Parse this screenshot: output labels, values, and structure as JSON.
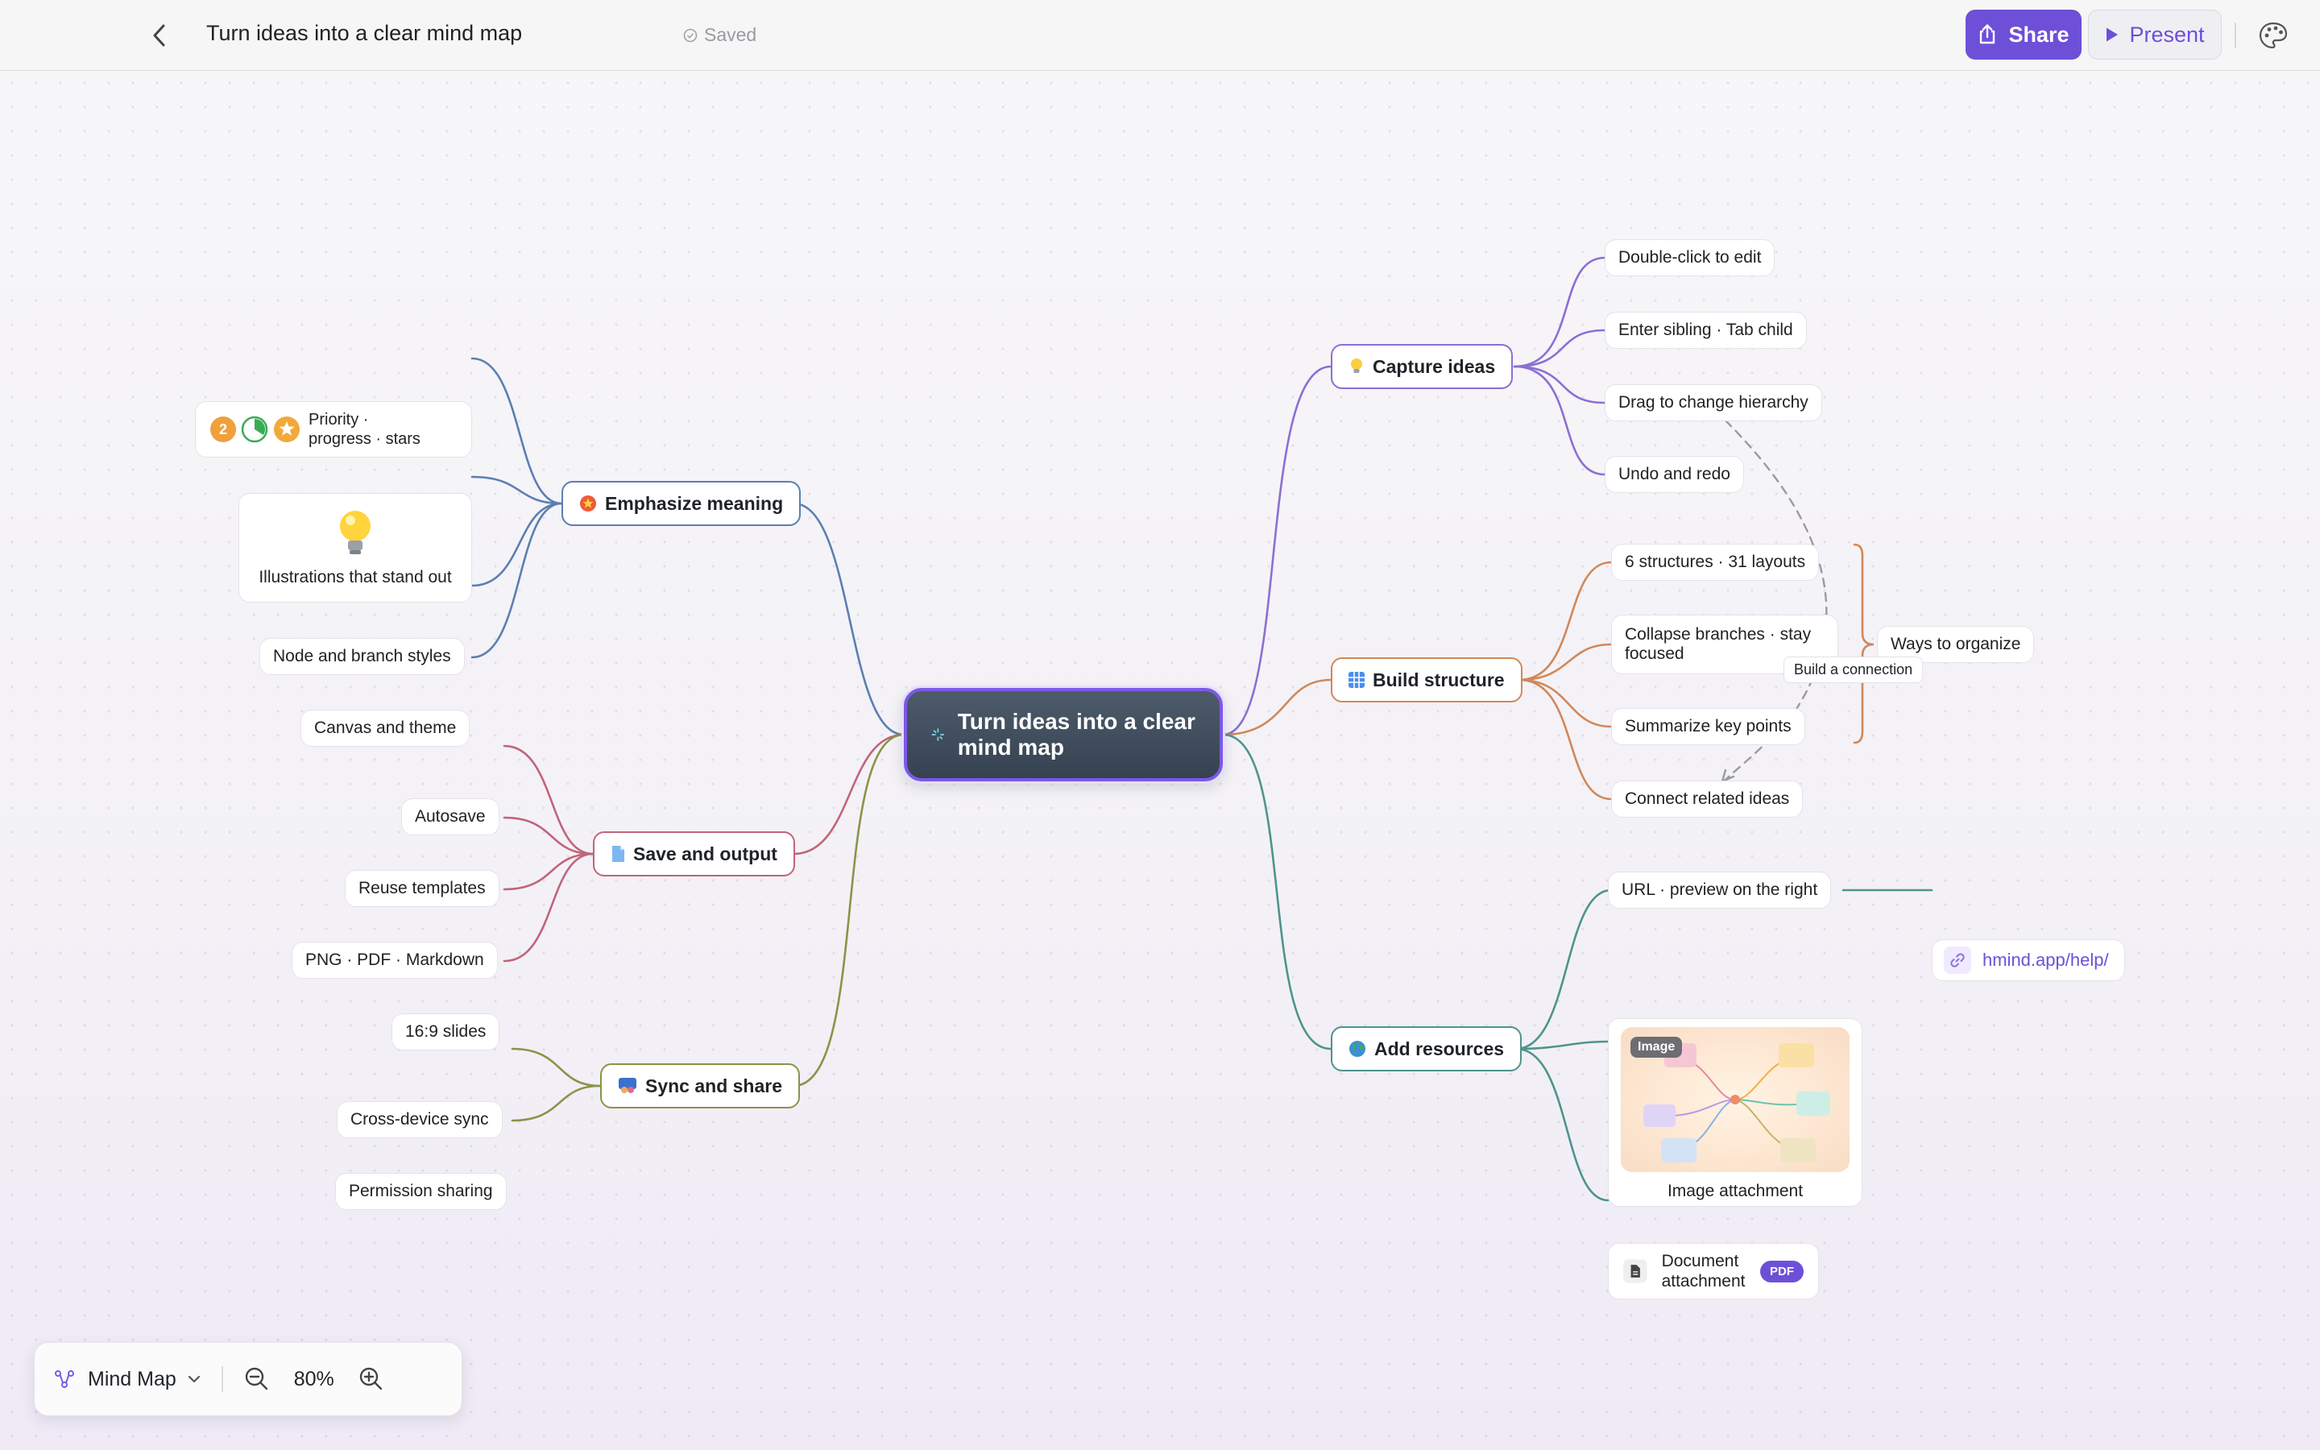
{
  "topbar": {
    "title": "Turn ideas into a clear mind map",
    "saved": "Saved",
    "share_label": "Share",
    "present_label": "Present"
  },
  "map": {
    "center": "Turn ideas into a clear mind map",
    "branches": {
      "capture": {
        "label": "Capture ideas",
        "color": "#8b6fd3",
        "items": [
          "Double-click to edit",
          "Enter sibling · Tab child",
          "Drag to change hierarchy",
          "Undo and redo"
        ]
      },
      "structure": {
        "label": "Build structure",
        "color": "#d0885a",
        "items": [
          "6 structures · 31 layouts",
          "Collapse branches · stay focused",
          "Summarize key points",
          "Connect related ideas"
        ],
        "summary": "Ways to organize",
        "connection_label": "Build a connection"
      },
      "resources": {
        "label": "Add resources",
        "color": "#4e948c",
        "url_item": "URL · preview on the right",
        "url_value": "hmind.app/help/",
        "image_tag": "Image",
        "image_caption": "Image attachment",
        "document": "Document attachment",
        "document_badge": "PDF"
      },
      "emphasize": {
        "label": "Emphasize meaning",
        "color": "#5b7fb2",
        "priority_badge": "2",
        "priority_text": "Priority · progress · stars",
        "illustration": "Illustrations that stand out",
        "items": [
          "Node and branch styles",
          "Canvas and theme"
        ]
      },
      "save": {
        "label": "Save and output",
        "color": "#c0657a",
        "items": [
          "Autosave",
          "Reuse templates",
          "PNG · PDF · Markdown",
          "16:9 slides"
        ]
      },
      "sync": {
        "label": "Sync and share",
        "color": "#8a9447",
        "items": [
          "Cross-device sync",
          "Permission sharing"
        ]
      }
    }
  },
  "zoombar": {
    "mode": "Mind Map",
    "zoom": "80%"
  }
}
